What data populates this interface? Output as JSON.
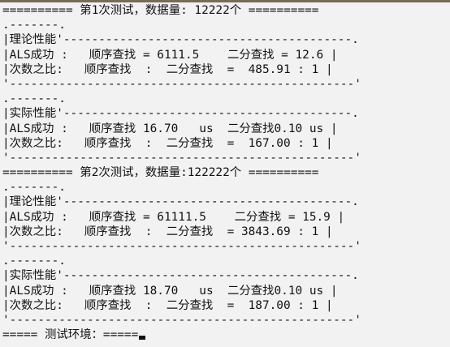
{
  "console": {
    "lines": [
      "========== 第1次测试，数据量: 12222个 ==========",
      ".-------.",
      "|理论性能'-----------------------------------------.",
      "|ALS成功 :   顺序查找 = 6111.5    二分查找 = 12.6 |",
      "|次数之比:   顺序查找  :  二分查找  =  485.91 : 1 |",
      "'-------------------------------------------------'",
      ".-------.",
      "|实际性能'-----------------------------------------.",
      "|ALS成功 :   顺序查找 16.70   us  二分查找0.10 us |",
      "|次数之比:   顺序查找  :  二分查找  =  167.00 : 1 |",
      "'-------------------------------------------------'",
      "========== 第2次测试，数据量:122222个 ==========",
      ".-------.",
      "|理论性能'-----------------------------------------.",
      "|ALS成功 :   顺序查找 = 61111.5    二分查找 = 15.9 |",
      "|次数之比:   顺序查找  :  二分查找  = 3843.69 : 1 |",
      "'-------------------------------------------------'",
      ".-------.",
      "|实际性能'-----------------------------------------.",
      "|ALS成功 :   顺序查找 18.70   us  二分查找0.10 us |",
      "|次数之比:   顺序查找  :  二分查找  =  187.00 : 1 |",
      "'-------------------------------------------------'"
    ],
    "prompt": "===== 测试环境：====="
  },
  "colors": {
    "background": "#f2f2f2",
    "text": "#111111",
    "window_edge": "#7a6a58"
  }
}
